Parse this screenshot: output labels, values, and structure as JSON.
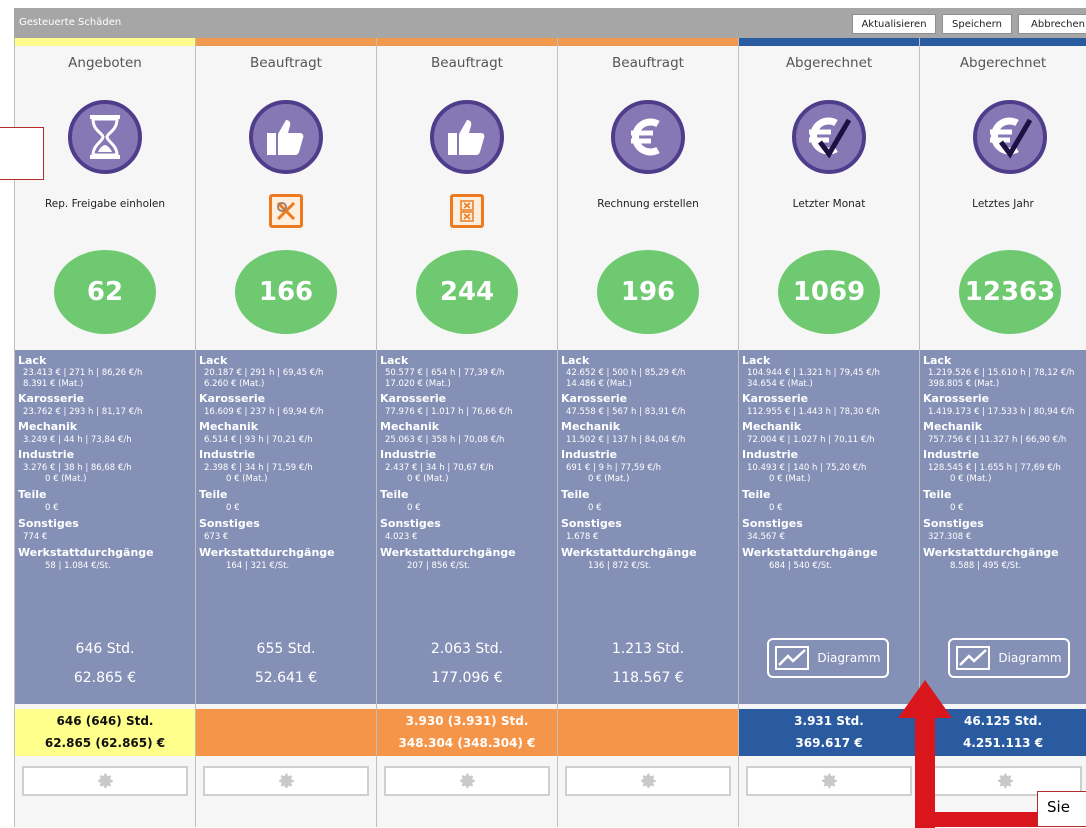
{
  "window": {
    "title": "Gesteuerte Schäden",
    "buttons": {
      "refresh": "Aktualisieren",
      "save": "Speichern",
      "cancel": "Abbrechen"
    }
  },
  "columns": [
    {
      "stage": "Angeboten",
      "strip_color": "#fdfb8c",
      "icon": "hourglass-icon",
      "subtitle": "Rep. Freigabe einholen",
      "count": "62",
      "lack": "23.413 € | 271 h | 86,26 €/h",
      "lack_mat": "8.391 € (Mat.)",
      "karosserie": "23.762 € | 293 h | 81,17 €/h",
      "mechanik": "3.249 € | 44 h | 73,84 €/h",
      "industrie": "3.276 € | 38 h | 86,68 €/h",
      "industrie_mat": "0 € (Mat.)",
      "teile": "0 €",
      "sonstiges": "774 €",
      "werkstatt": "58 | 1.084 €/St.",
      "sum_hours": "646 Std.",
      "sum_amount": "62.865 €",
      "total_bg": "#ffff8c",
      "total_color": "#111111",
      "total_line1": "646 (646) Std.",
      "total_line2": "62.865 (62.865) €"
    },
    {
      "stage": "Beauftragt",
      "strip_color": "#f0994f",
      "icon": "thumbs-up-icon",
      "subtitle": "",
      "badge": "wrench-cross-badge-icon",
      "count": "166",
      "lack": "20.187 € | 291 h | 69,45 €/h",
      "lack_mat": "6.260 € (Mat.)",
      "karosserie": "16.609 € | 237 h | 69,94 €/h",
      "mechanik": "6.514 € | 93 h | 70,21 €/h",
      "industrie": "2.398 € | 34 h | 71,59 €/h",
      "industrie_mat": "0 € (Mat.)",
      "teile": "0 €",
      "sonstiges": "673 €",
      "werkstatt": "164 | 321 €/St.",
      "sum_hours": "655 Std.",
      "sum_amount": "52.641 €",
      "total_bg": "#f5954a",
      "total_color": "#ffffff",
      "total_line1": "",
      "total_line2": ""
    },
    {
      "stage": "Beauftragt",
      "strip_color": "#f0994f",
      "icon": "thumbs-up-icon",
      "subtitle": "",
      "badge": "document-x-badge-icon",
      "count": "244",
      "lack": "50.577 € | 654 h | 77,39 €/h",
      "lack_mat": "17.020 € (Mat.)",
      "karosserie": "77.976 € | 1.017 h | 76,66 €/h",
      "mechanik": "25.063 € | 358 h | 70,08 €/h",
      "industrie": "2.437 € | 34 h | 70,67 €/h",
      "industrie_mat": "0 € (Mat.)",
      "teile": "0 €",
      "sonstiges": "4.023 €",
      "werkstatt": "207 | 856 €/St.",
      "sum_hours": "2.063 Std.",
      "sum_amount": "177.096 €",
      "total_bg": "#f5954a",
      "total_color": "#ffffff",
      "total_line1": "3.930 (3.931) Std.",
      "total_line2": "348.304 (348.304) €"
    },
    {
      "stage": "Beauftragt",
      "strip_color": "#f0994f",
      "icon": "euro-icon",
      "subtitle": "Rechnung erstellen",
      "count": "196",
      "lack": "42.652 € | 500 h | 85,29 €/h",
      "lack_mat": "14.486 € (Mat.)",
      "karosserie": "47.558 € | 567 h | 83,91 €/h",
      "mechanik": "11.502 € | 137 h | 84,04 €/h",
      "industrie": "691 € | 9 h | 77,59 €/h",
      "industrie_mat": "0 € (Mat.)",
      "teile": "0 €",
      "sonstiges": "1.678 €",
      "werkstatt": "136 | 872 €/St.",
      "sum_hours": "1.213 Std.",
      "sum_amount": "118.567 €",
      "total_bg": "#f5954a",
      "total_color": "#ffffff",
      "total_line1": "",
      "total_line2": ""
    },
    {
      "stage": "Abgerechnet",
      "strip_color": "#2a5aa0",
      "icon": "euro-check-icon",
      "subtitle": "Letzter Monat",
      "count": "1069",
      "lack": "104.944 € | 1.321 h | 79,45 €/h",
      "lack_mat": "34.654 € (Mat.)",
      "karosserie": "112.955 € | 1.443 h | 78,30 €/h",
      "mechanik": "72.004 € | 1.027 h | 70,11 €/h",
      "industrie": "10.493 € | 140 h | 75,20 €/h",
      "industrie_mat": "0 € (Mat.)",
      "teile": "0 €",
      "sonstiges": "34.567 €",
      "werkstatt": "684 | 540 €/St.",
      "diagram": "Diagramm",
      "total_bg": "#2a5aa0",
      "total_color": "#ffffff",
      "total_line1": "3.931 Std.",
      "total_line2": "369.617 €"
    },
    {
      "stage": "Abgerechnet",
      "strip_color": "#2a5aa0",
      "icon": "euro-check-icon",
      "subtitle": "Letztes Jahr",
      "count": "12363",
      "lack": "1.219.526 € | 15.610 h | 78,12 €/h",
      "lack_mat": "398.805 € (Mat.)",
      "karosserie": "1.419.173 € | 17.533 h | 80,94 €/h",
      "mechanik": "757.756 € | 11.327 h | 66,90 €/h",
      "industrie": "128.545 € | 1.655 h | 77,69 €/h",
      "industrie_mat": "0 € (Mat.)",
      "teile": "0 €",
      "sonstiges": "327.308 €",
      "werkstatt": "8.588 | 495 €/St.",
      "diagram": "Diagramm",
      "total_bg": "#2a5aa0",
      "total_color": "#ffffff",
      "total_line1": "46.125 Std.",
      "total_line2": "4.251.113 €"
    }
  ],
  "labels": {
    "lack": "Lack",
    "karosserie": "Karosserie",
    "mechanik": "Mechanik",
    "industrie": "Industrie",
    "teile": "Teile",
    "sonstiges": "Sonstiges",
    "werkstatt": "Werkstattdurchgänge"
  },
  "callout": {
    "text": "Sie"
  },
  "colors": {
    "accent_red": "#d9161c",
    "count_green": "#6ec971",
    "stats_bg": "#8590b6",
    "icon_purple": "#8677b5"
  }
}
